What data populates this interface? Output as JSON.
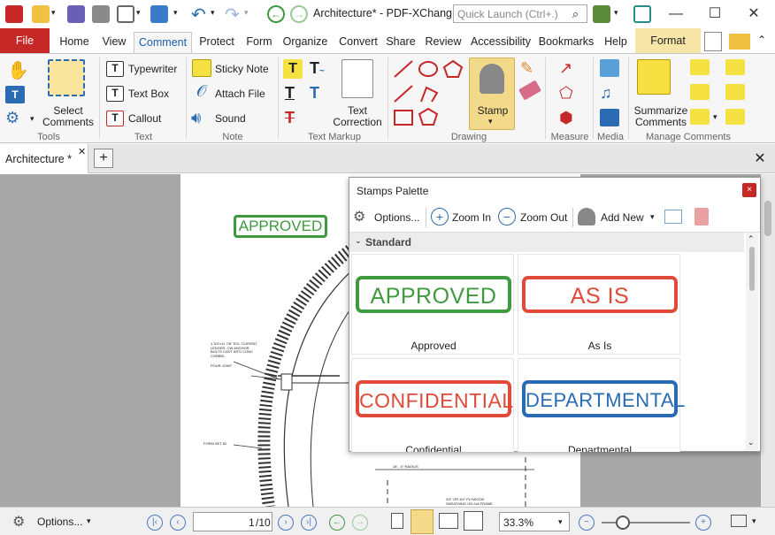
{
  "window": {
    "title": "Architecture* - PDF-XChang...",
    "search_placeholder": "Quick Launch (Ctrl+.)",
    "minimize_glyph": "—",
    "maximize_glyph": "☐",
    "close_glyph": "✕"
  },
  "tabs": [
    "File",
    "Home",
    "View",
    "Comment",
    "Protect",
    "Form",
    "Organize",
    "Convert",
    "Share",
    "Review",
    "Accessibility",
    "Bookmarks",
    "Help",
    "Format"
  ],
  "ribbon": {
    "tools": {
      "select_comments": "Select Comments",
      "group": "Tools"
    },
    "text": {
      "typewriter": "Typewriter",
      "text_box": "Text Box",
      "callout": "Callout",
      "group": "Text"
    },
    "note": {
      "sticky_note": "Sticky Note",
      "attach_file": "Attach File",
      "sound": "Sound",
      "group": "Note"
    },
    "markup": {
      "text_correction": "Text Correction",
      "group": "Text Markup"
    },
    "drawing": {
      "stamp": "Stamp",
      "group": "Drawing"
    },
    "measure": {
      "group": "Measure"
    },
    "media": {
      "group": "Media"
    },
    "manage": {
      "summarize": "Summarize Comments",
      "group": "Manage Comments"
    }
  },
  "document": {
    "tab_label": "Architecture *",
    "page_stamp": "APPROVED",
    "drawing_notes": [
      "1 3/4\"x11 7/8\" SCL 'CURVED'",
      "LEDGER, CW ANCHOR",
      "BOLTS CAST INTO CONC",
      "CORBEL",
      "POUR JOINT",
      "FORM SET 82",
      "18' - 0\" RADIUS",
      "3/4\" OR 3/4\" PLYWOOD",
      "SHEATHING ON 2x6 FRAME"
    ]
  },
  "palette": {
    "title": "Stamps Palette",
    "options": "Options...",
    "zoom_in": "Zoom In",
    "zoom_out": "Zoom Out",
    "add_new": "Add New",
    "section": "Standard",
    "stamps": [
      {
        "text": "APPROVED",
        "label": "Approved",
        "color": "#3f9a3f"
      },
      {
        "text": "AS IS",
        "label": "As Is",
        "color": "#e04a3a"
      },
      {
        "text": "CONFIDENTIAL",
        "label": "Confidential",
        "color": "#e04a3a"
      },
      {
        "text": "DEPARTMENTAL",
        "label": "Departmental",
        "color": "#2a6bb3"
      }
    ]
  },
  "statusbar": {
    "options": "Options...",
    "page": "1",
    "page_total": "/10",
    "zoom": "33.3%"
  },
  "colors": {
    "accent": "#1b5fa7",
    "file_tab": "#c62828",
    "format_tab": "#f7e6a8",
    "workspace": "#a8a8a8"
  }
}
